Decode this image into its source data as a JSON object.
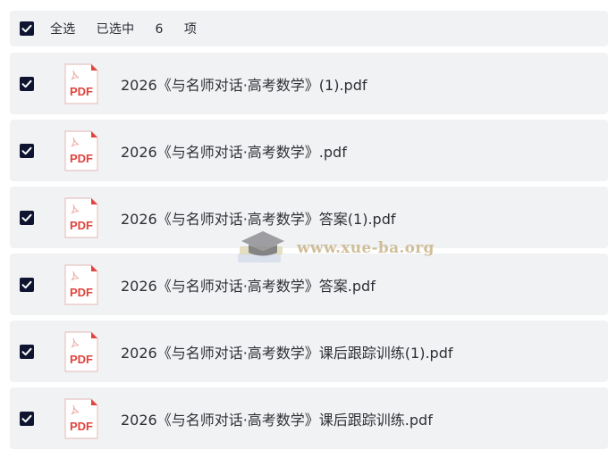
{
  "header": {
    "select_all_label": "全选",
    "selected_prefix": "已选中",
    "selected_count": "6",
    "selected_suffix": "项",
    "select_all_checked": true
  },
  "file_icon": {
    "label": "PDF",
    "accent_color": "#e0443c"
  },
  "files": [
    {
      "name": "2026《与名师对话·高考数学》(1).pdf",
      "checked": true
    },
    {
      "name": "2026《与名师对话·高考数学》.pdf",
      "checked": true
    },
    {
      "name": "2026《与名师对话·高考数学》答案(1).pdf",
      "checked": true
    },
    {
      "name": "2026《与名师对话·高考数学》答案.pdf",
      "checked": true
    },
    {
      "name": "2026《与名师对话·高考数学》课后跟踪训练(1).pdf",
      "checked": true
    },
    {
      "name": "2026《与名师对话·高考数学》课后跟踪训练.pdf",
      "checked": true
    }
  ],
  "watermark": {
    "text": "www.xue-ba.org"
  },
  "colors": {
    "checkbox_fill": "#0f1530",
    "row_background": "#f1f2f4",
    "pdf_red": "#e0443c"
  }
}
